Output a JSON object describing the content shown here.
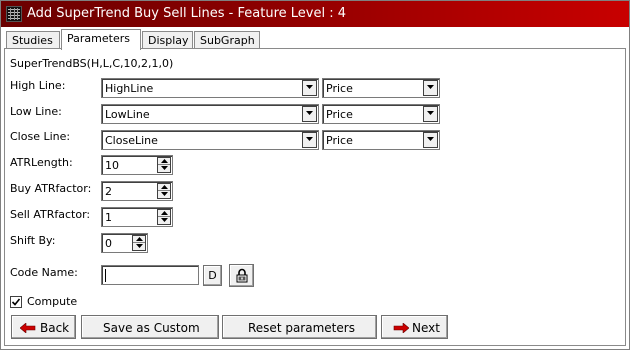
{
  "window": {
    "title": "Add SuperTrend Buy Sell Lines - Feature Level : 4"
  },
  "tabs": [
    {
      "label": "Studies"
    },
    {
      "label": "Parameters"
    },
    {
      "label": "Display"
    },
    {
      "label": "SubGraph"
    }
  ],
  "formula": "SuperTrendBS(H,L,C,10,2,1,0)",
  "fields": {
    "high_line": {
      "label": "High Line:",
      "value": "HighLine",
      "type_value": "Price"
    },
    "low_line": {
      "label": "Low Line:",
      "value": "LowLine",
      "type_value": "Price"
    },
    "close_line": {
      "label": "Close Line:",
      "value": "CloseLine",
      "type_value": "Price"
    },
    "atr_length": {
      "label": "ATRLength:",
      "value": "10"
    },
    "buy_atr_factor": {
      "label": "Buy ATRfactor:",
      "value": "2"
    },
    "sell_atr_factor": {
      "label": "Sell ATRfactor:",
      "value": "1"
    },
    "shift_by": {
      "label": "Shift By:",
      "value": "0"
    },
    "code_name": {
      "label": "Code Name:",
      "value": "",
      "d_button": "D"
    }
  },
  "compute": {
    "label": "Compute",
    "checked": true
  },
  "buttons": {
    "back": "Back",
    "save_custom": "Save as Custom",
    "reset": "Reset parameters",
    "next": "Next"
  },
  "colors": {
    "title_bar": "#8a0000",
    "arrow_red": "#cc0000"
  },
  "icons": {
    "title": "app-icon",
    "dropdown": "chevron-down-icon",
    "lock": "lock-icon",
    "back": "arrow-left-icon",
    "next": "arrow-right-icon"
  }
}
